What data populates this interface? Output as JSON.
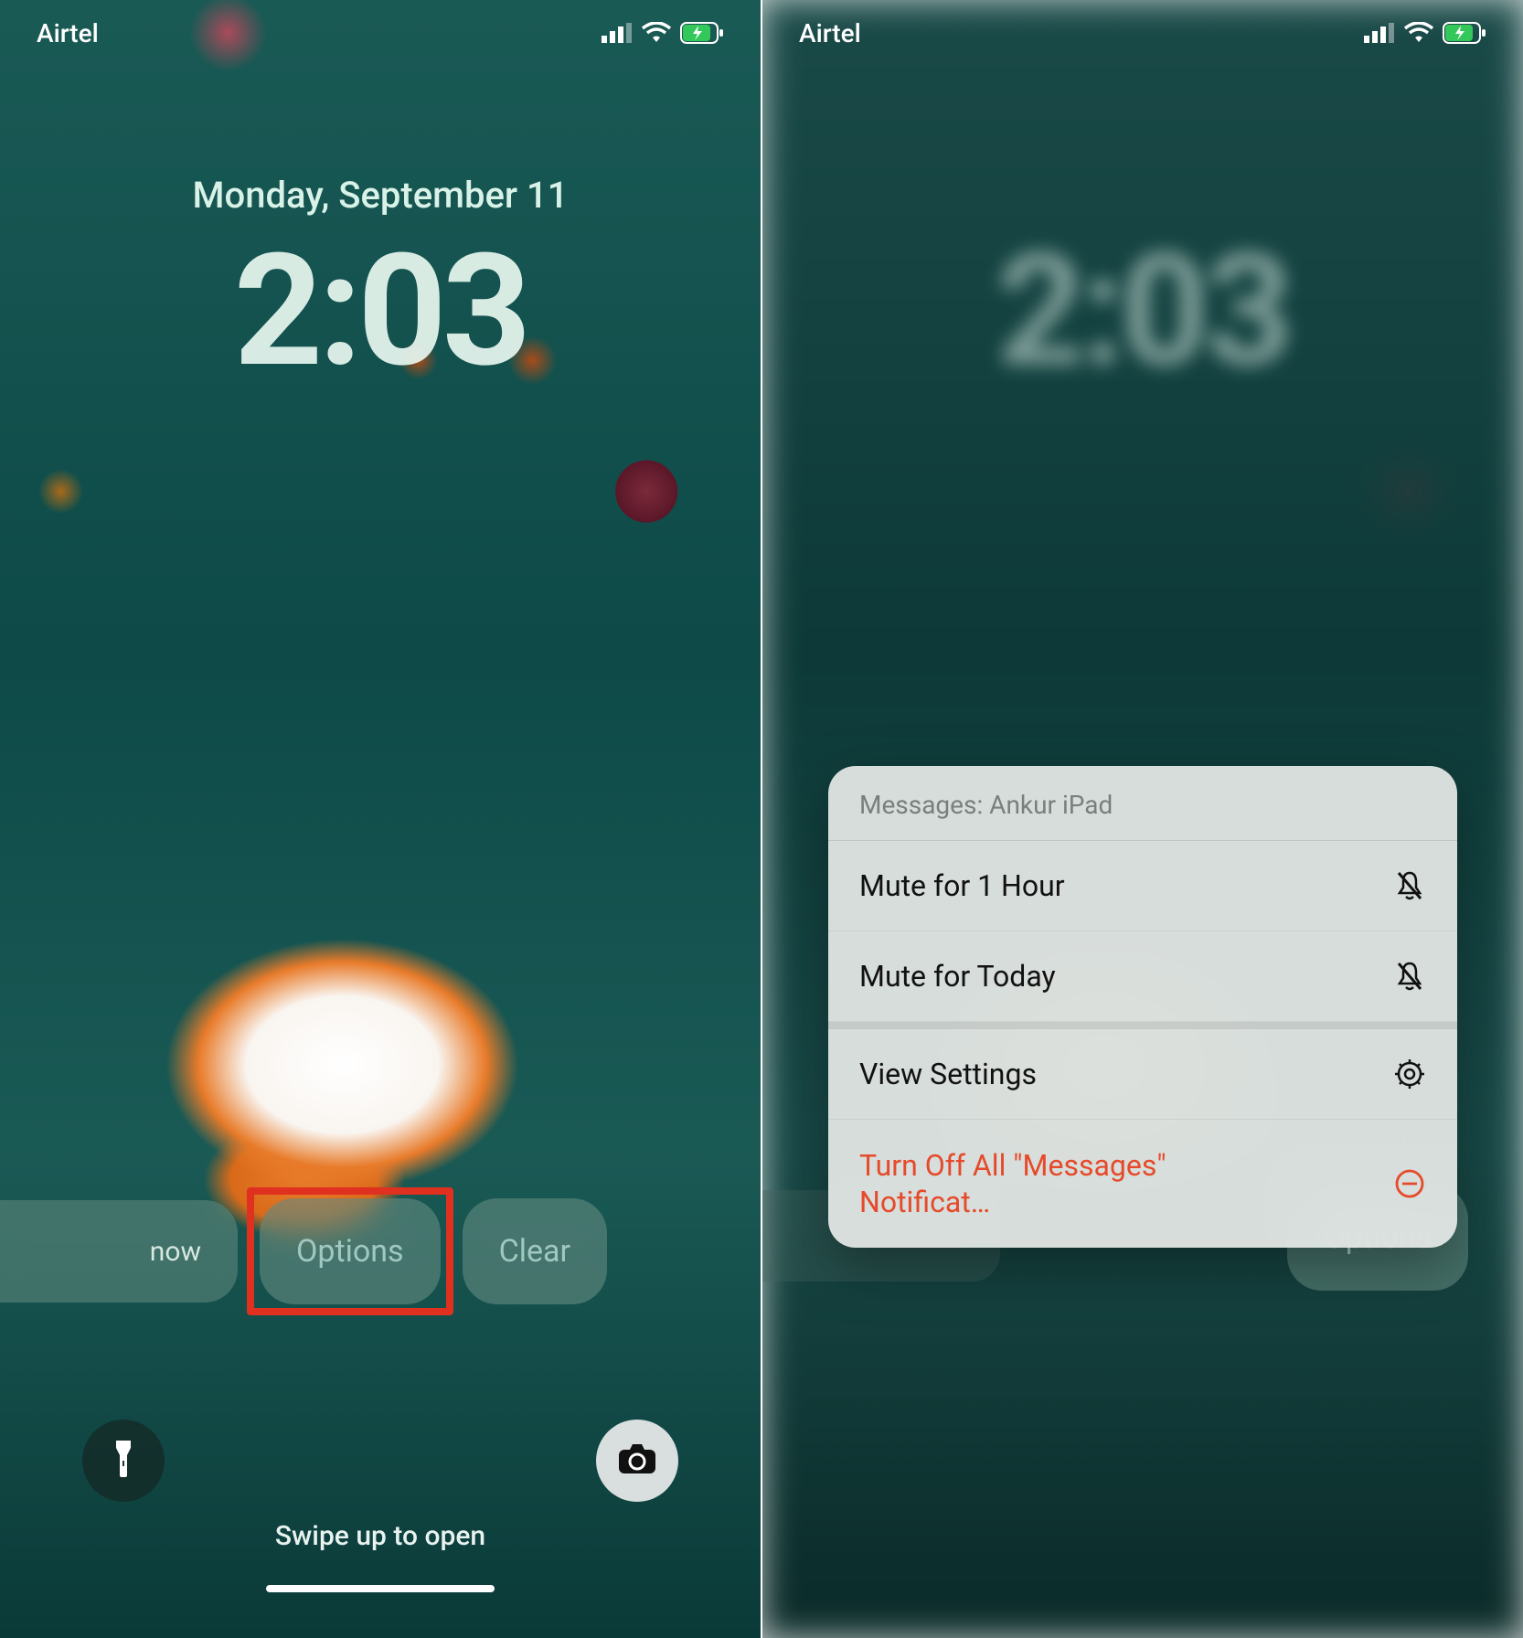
{
  "statusbar": {
    "carrier": "Airtel"
  },
  "lockscreen": {
    "date": "Monday, September 11",
    "time": "2:03",
    "swipe_hint": "Swipe up to open"
  },
  "notification": {
    "timestamp": "now",
    "options_label": "Options",
    "clear_label": "Clear"
  },
  "context_menu": {
    "header": "Messages: Ankur iPad",
    "mute_hour": "Mute for 1 Hour",
    "mute_today": "Mute for Today",
    "view_settings": "View Settings",
    "turn_off_all": "Turn Off All \"Messages\" Notificat…"
  },
  "right_panel": {
    "options_label": "Options"
  }
}
